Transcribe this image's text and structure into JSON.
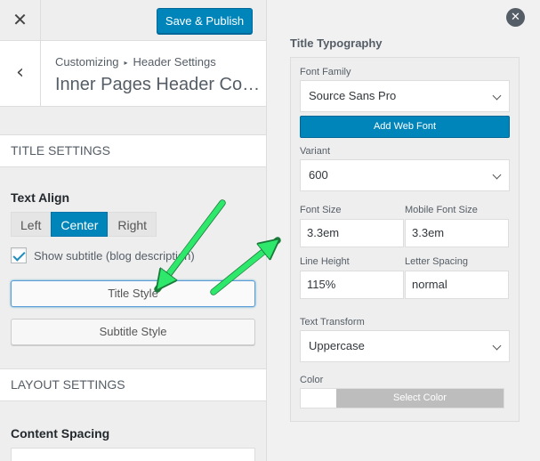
{
  "topbar": {
    "close_glyph": "✕",
    "publish_label": "Save & Publish"
  },
  "breadcrumb": {
    "root": "Customizing",
    "separator": "▸",
    "parent": "Header Settings",
    "back_glyph": "‹",
    "current": "Inner Pages Header Content"
  },
  "title_settings": {
    "heading": "TITLE SETTINGS",
    "align_label": "Text Align",
    "align_options": [
      "Left",
      "Center",
      "Right"
    ],
    "align_selected": "Center",
    "subtitle_checkbox_label": "Show subtitle (blog description)",
    "subtitle_checked": true,
    "title_style_button": "Title Style",
    "subtitle_style_button": "Subtitle Style"
  },
  "layout_settings": {
    "heading": "LAYOUT SETTINGS",
    "spacing_label": "Content Spacing"
  },
  "typography": {
    "close_glyph": "✕",
    "heading": "Title Typography",
    "font_family_label": "Font Family",
    "font_family_value": "Source Sans Pro",
    "add_web_font_label": "Add Web Font",
    "variant_label": "Variant",
    "variant_value": "600",
    "font_size_label": "Font Size",
    "font_size_value": "3.3em",
    "mobile_font_size_label": "Mobile Font Size",
    "mobile_font_size_value": "3.3em",
    "line_height_label": "Line Height",
    "line_height_value": "115%",
    "letter_spacing_label": "Letter Spacing",
    "letter_spacing_value": "normal",
    "text_transform_label": "Text Transform",
    "text_transform_value": "Uppercase",
    "color_label": "Color",
    "select_color_label": "Select Color"
  },
  "colors": {
    "primary_button": "#0085ba",
    "annotation_arrow": "#2ee86b"
  },
  "icons": [
    "close-icon",
    "back-chevron-icon",
    "checkbox-check-icon",
    "dropdown-chevron-icon",
    "close-circle-icon",
    "arrow-annotation"
  ]
}
